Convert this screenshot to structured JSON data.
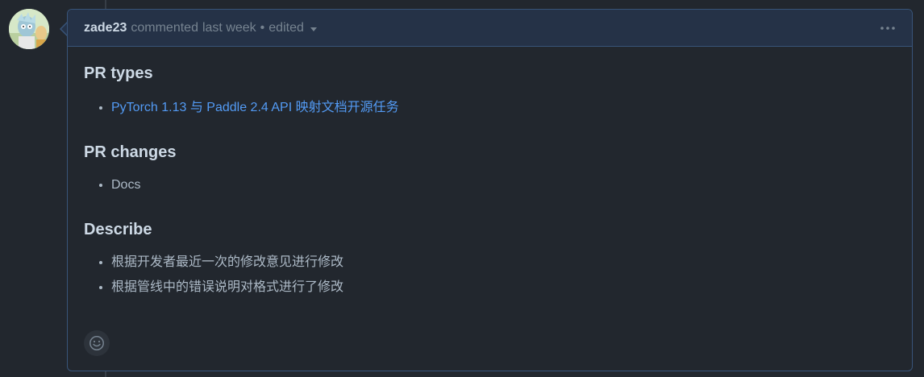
{
  "comment": {
    "author": "zade23",
    "action": "commented",
    "time": "last week",
    "separator": "•",
    "edited_label": "edited",
    "menu_icon": "kebab-horizontal-icon",
    "avatar_icon": "user-avatar-image"
  },
  "body": {
    "sections": [
      {
        "heading": "PR types",
        "items": [
          "PyTorch 1.13 与 Paddle 2.4 API 映射文档开源任务"
        ]
      },
      {
        "heading": "PR changes",
        "items": [
          "Docs"
        ]
      },
      {
        "heading": "Describe",
        "items": [
          "根据开发者最近一次的修改意见进行修改",
          "根据管线中的错误说明对格式进行了修改"
        ]
      }
    ]
  },
  "reactions": {
    "icon": "smiley-icon"
  },
  "colors": {
    "background": "#22272e",
    "header_bg": "#253247",
    "border": "#385479",
    "link": "#539bf5"
  }
}
